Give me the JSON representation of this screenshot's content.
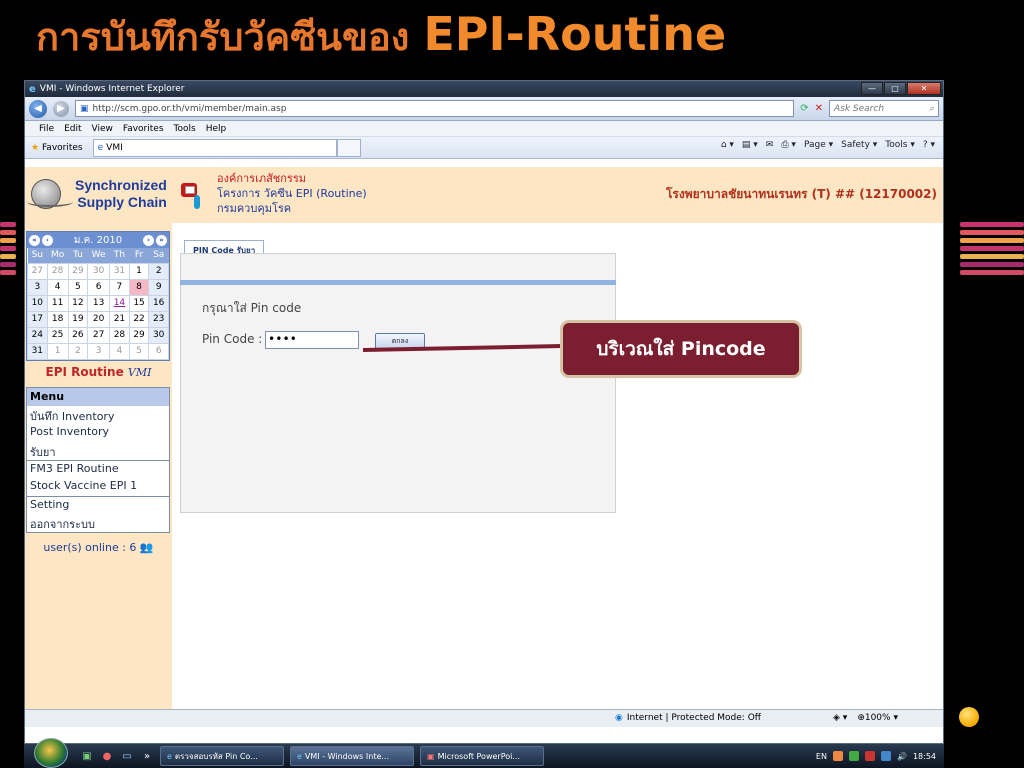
{
  "slide": {
    "title_thai": "การบันทึกรับวัคซีนของ",
    "title_en": "EPI-Routine",
    "callout": "บริเวณใส่ Pincode"
  },
  "browser": {
    "window_title": "VMI - Windows Internet Explorer",
    "url": "http://scm.gpo.or.th/vmi/member/main.asp",
    "search_placeholder": "Ask Search",
    "menu": [
      "File",
      "Edit",
      "View",
      "Favorites",
      "Tools",
      "Help"
    ],
    "favorites_label": "Favorites",
    "tab_label": "VMI",
    "commands": [
      "Page ▾",
      "Safety ▾",
      "Tools ▾"
    ],
    "status_zone": "Internet | Protected Mode: Off",
    "zoom": "100%"
  },
  "header": {
    "logo_line1": "Synchronized",
    "logo_line2": "Supply Chain",
    "org_line1": "องค์การเภสัชกรรม",
    "org_line2": "โครงการ วัคซีน EPI (Routine)",
    "org_line3": "กรมควบคุมโรค",
    "hospital": "โรงพยาบาลชัยนาทนเรนทร (T) ## (12170002)"
  },
  "calendar": {
    "month_label": "ม.ค. 2010",
    "days": [
      "Su",
      "Mo",
      "Tu",
      "We",
      "Th",
      "Fr",
      "Sa"
    ],
    "weeks": [
      [
        "27",
        "28",
        "29",
        "30",
        "31",
        "1",
        "2"
      ],
      [
        "3",
        "4",
        "5",
        "6",
        "7",
        "8",
        "9"
      ],
      [
        "10",
        "11",
        "12",
        "13",
        "14",
        "15",
        "16"
      ],
      [
        "17",
        "18",
        "19",
        "20",
        "21",
        "22",
        "23"
      ],
      [
        "24",
        "25",
        "26",
        "27",
        "28",
        "29",
        "30"
      ],
      [
        "31",
        "1",
        "2",
        "3",
        "4",
        "5",
        "6"
      ]
    ],
    "today": "8",
    "selected": "14"
  },
  "sidebar": {
    "brand_text": "EPI Routine",
    "brand_logo": "VMI",
    "menu_title": "Menu",
    "items": [
      "บันทึก Inventory",
      "Post Inventory",
      "รับยา",
      "FM3 EPI Routine",
      "Stock Vaccine EPI 1",
      "Setting",
      "ออกจากระบบ"
    ],
    "online": "user(s) online : 6"
  },
  "form": {
    "tab_label": "PIN Code รับยา",
    "prompt": "กรุณาใส่ Pin code",
    "pin_label": "Pin Code :",
    "pin_value": "••••",
    "ok_label": "ตกลง"
  },
  "taskbar": {
    "buttons": [
      "ตรวจสอบรหัส Pin Co...",
      "VMI - Windows Inte...",
      "Microsoft PowerPoi..."
    ],
    "lang": "EN",
    "time": "18:54"
  },
  "colors": {
    "title_orange": "#e8772e",
    "callout_bg": "#7b1e2f",
    "header_bg": "#fde6c4",
    "brand_blue": "#1f3b9b"
  }
}
